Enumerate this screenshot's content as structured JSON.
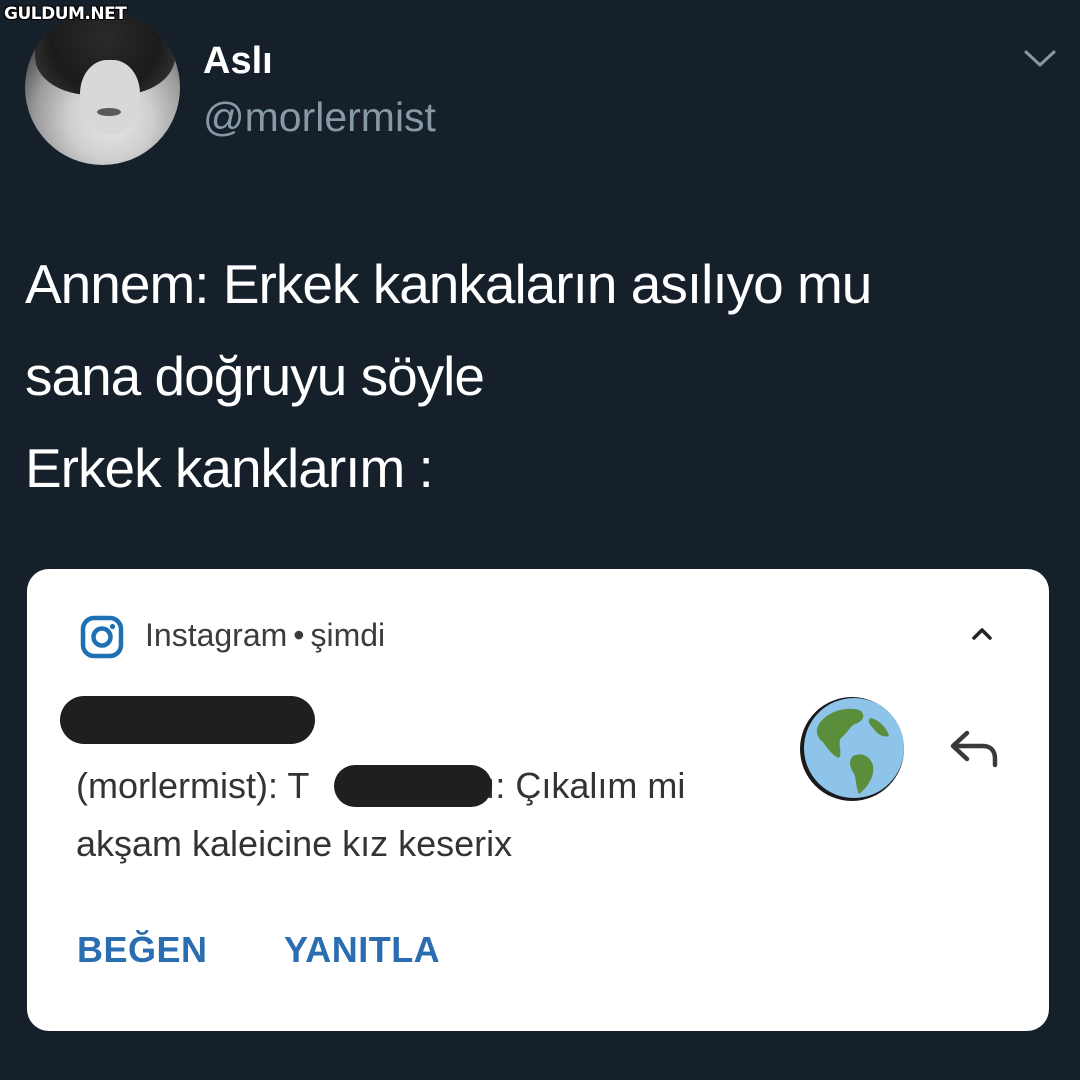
{
  "watermark": "GULDUM.NET",
  "tweet": {
    "display_name": "Aslı",
    "handle": "@morlermist",
    "lines": [
      "Annem: Erkek kankaların asılıyo mu",
      "sana doğruyu söyle",
      "Erkek kanklarım :"
    ]
  },
  "notification": {
    "app_name": "Instagram",
    "separator": "•",
    "time": "şimdi",
    "icons": {
      "app": "instagram-icon",
      "collapse": "chevron-up-icon",
      "sender_avatar": "globe-icon",
      "reply": "reply-arrow-icon"
    },
    "message": {
      "line1_prefix": "(morlermist): T",
      "line1_suffix": "nlı: Çıkalım mi",
      "line2": "akşam kaleicine kız keserix"
    },
    "actions": {
      "like": "BEĞEN",
      "reply": "YANITLA"
    }
  },
  "colors": {
    "background": "#15202b",
    "handle": "#8899a6",
    "action": "#2a6db0",
    "instagram_icon": "#1e6fb4"
  }
}
